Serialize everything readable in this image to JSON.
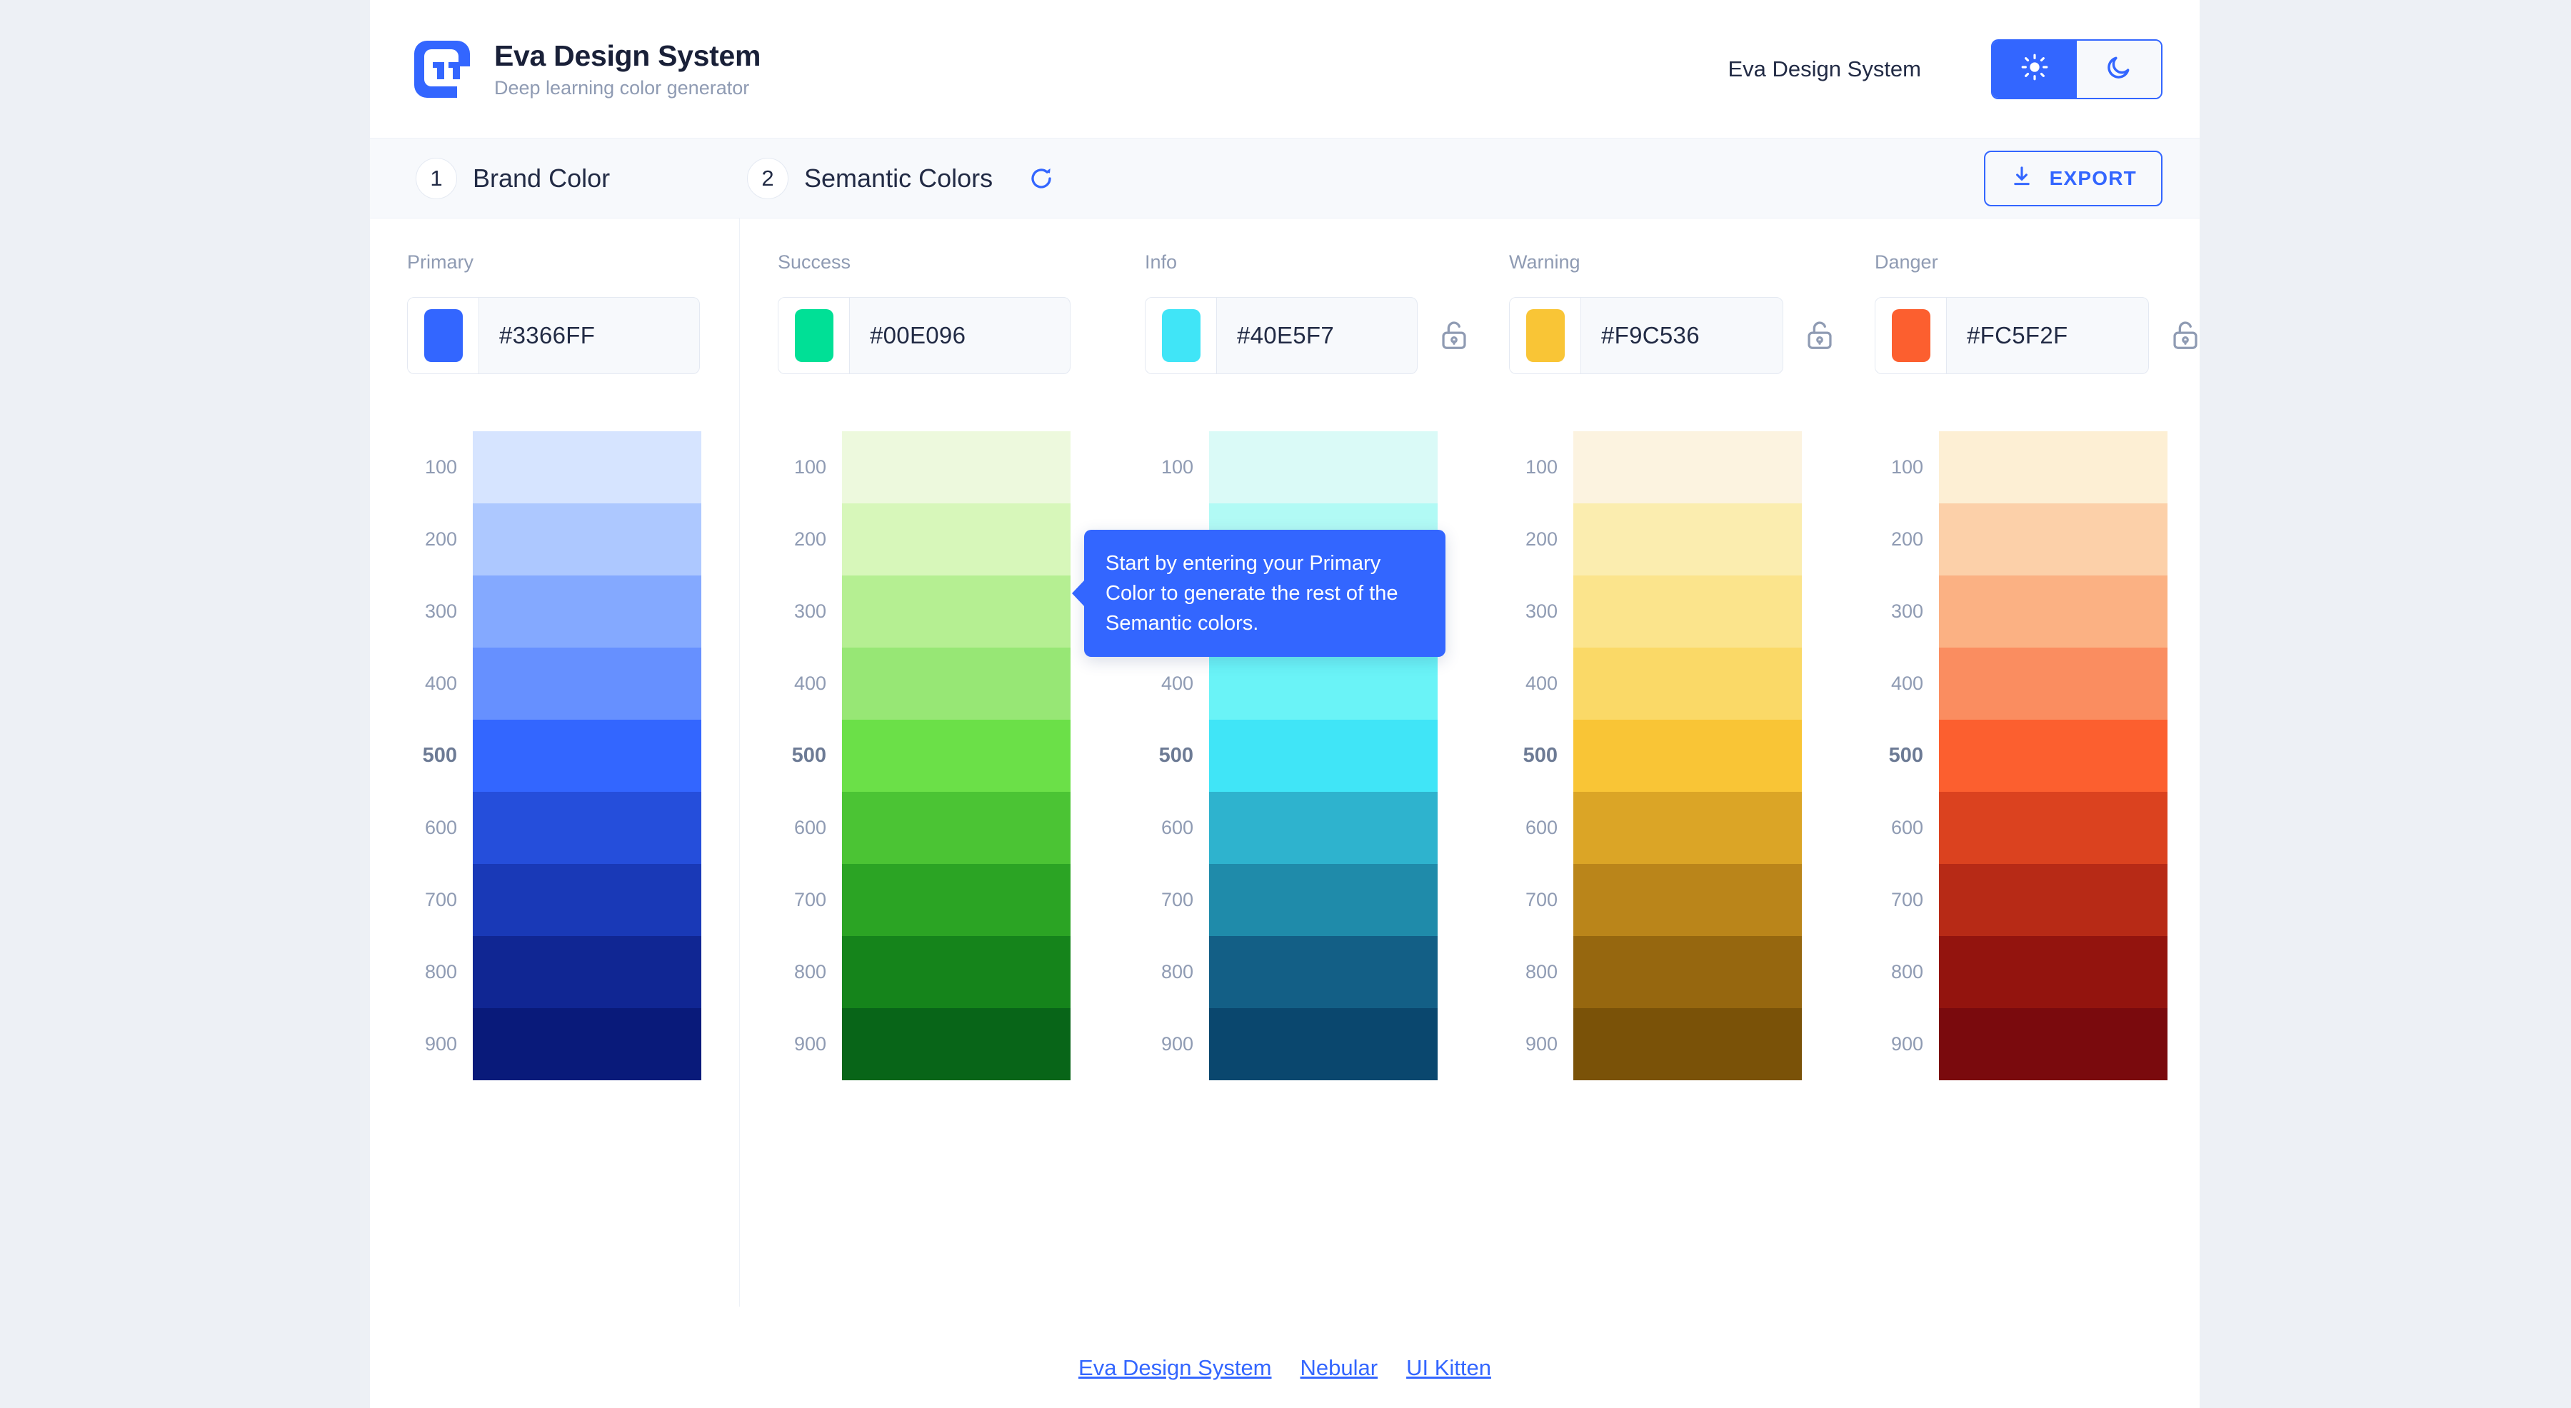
{
  "header": {
    "brand_title": "Eva Design System",
    "brand_subtitle": "Deep learning color generator",
    "right_label": "Eva Design System",
    "theme": {
      "light_icon": "sun-icon",
      "dark_icon": "moon-icon",
      "active": "light"
    }
  },
  "toolbar": {
    "step1_number": "1",
    "step1_title": "Brand Color",
    "step2_number": "2",
    "step2_title": "Semantic Colors",
    "refresh_icon": "refresh-icon",
    "export_label": "EXPORT",
    "export_icon": "download-icon"
  },
  "tooltip": {
    "text": "Start by entering your Primary Color to generate the rest of the Semantic colors."
  },
  "accent": "#3366ff",
  "scale_keys": [
    "100",
    "200",
    "300",
    "400",
    "500",
    "600",
    "700",
    "800",
    "900"
  ],
  "palettes": [
    {
      "name": "Primary",
      "hex": "#3366FF",
      "locked": false,
      "has_lock": false,
      "shades": [
        "#D6E4FF",
        "#ADC8FF",
        "#84A9FF",
        "#6690FF",
        "#3366FF",
        "#254EDB",
        "#1939B7",
        "#102693",
        "#091A7A"
      ]
    },
    {
      "name": "Success",
      "hex": "#00E096",
      "locked": false,
      "has_lock": false,
      "shades": [
        "#EDF9DD",
        "#D7F7BA",
        "#B5EF92",
        "#97E775",
        "#6BE048",
        "#4BC434",
        "#2BA424",
        "#15841B",
        "#086518"
      ]
    },
    {
      "name": "Info",
      "hex": "#40E5F7",
      "locked": false,
      "has_lock": true,
      "shades": [
        "#DAFAF7",
        "#B1FAF5",
        "#8CF8F5",
        "#6AF3F7",
        "#40E5F7",
        "#2EB3CE",
        "#1F8BAA",
        "#135F86",
        "#0A476E"
      ]
    },
    {
      "name": "Warning",
      "hex": "#F9C536",
      "locked": false,
      "has_lock": true,
      "shades": [
        "#FCF3E0",
        "#FBEDAF",
        "#FBE48C",
        "#FAD967",
        "#F9C536",
        "#DBA526",
        "#BA851A",
        "#96670F",
        "#7A5208"
      ]
    },
    {
      "name": "Danger",
      "hex": "#FC5F2F",
      "locked": false,
      "has_lock": true,
      "shades": [
        "#FDEFD4",
        "#FCD0A9",
        "#FBB183",
        "#FA8D60",
        "#FC5F2F",
        "#DB421F",
        "#B72A16",
        "#93140E",
        "#7A0A0D"
      ]
    }
  ],
  "footer": {
    "links": [
      "Eva Design System",
      "Nebular",
      "UI Kitten"
    ]
  }
}
